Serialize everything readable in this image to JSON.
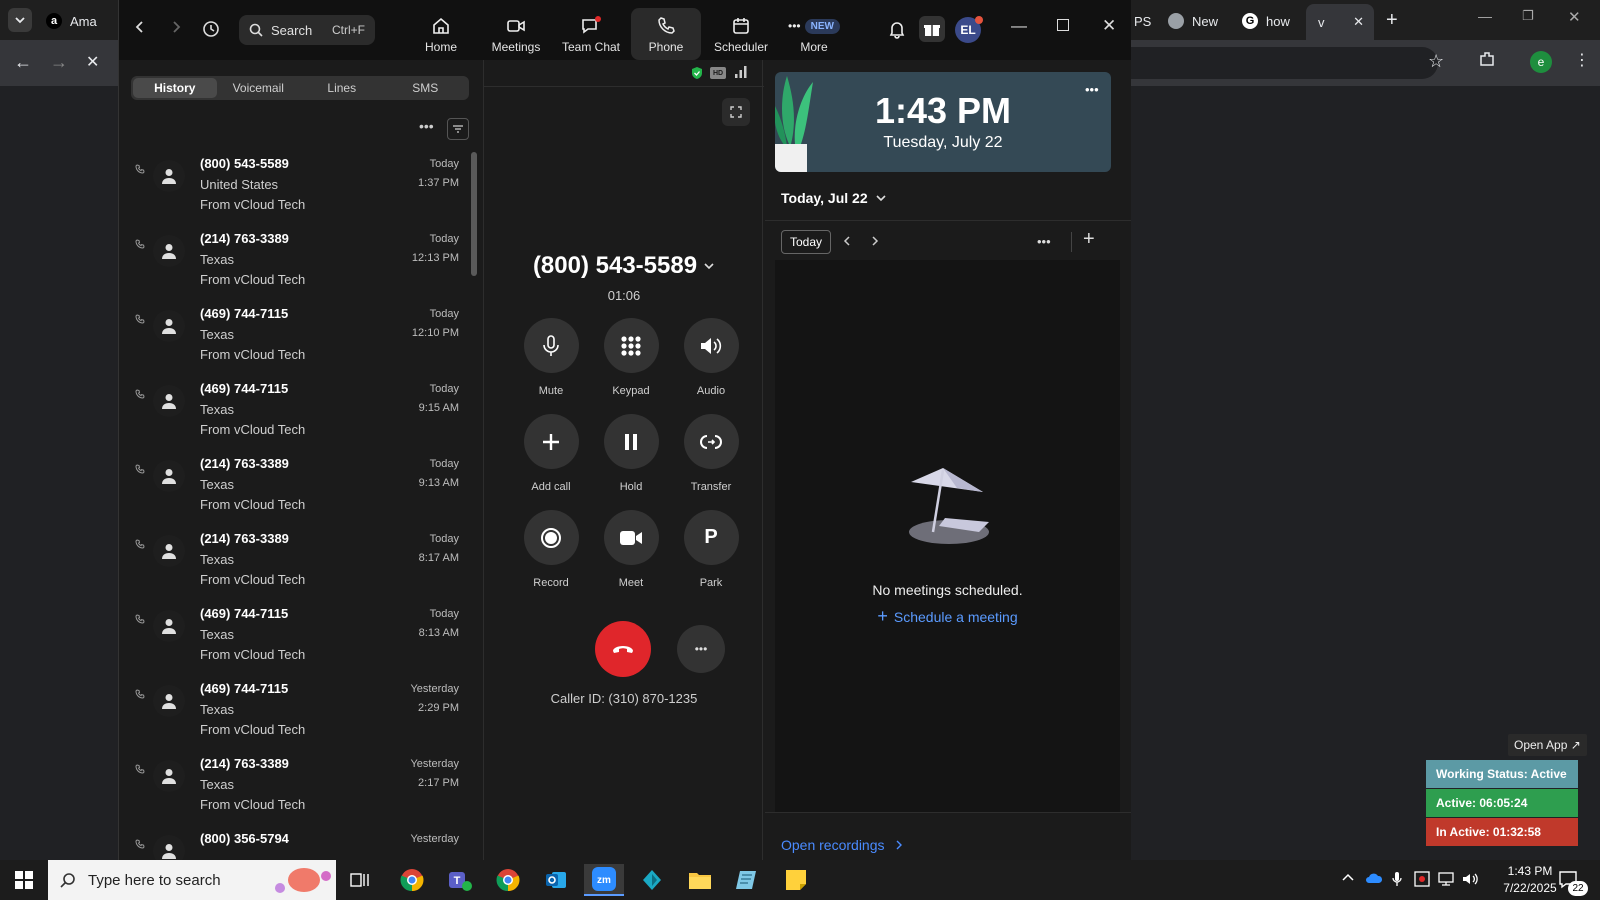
{
  "browser": {
    "tabs_left": [
      {
        "label": "Ama"
      }
    ],
    "tabs_right": [
      {
        "label": "PS"
      },
      {
        "label": "New"
      },
      {
        "label": "how"
      },
      {
        "label": "v"
      }
    ],
    "profile_initial": "e"
  },
  "zoom": {
    "search": {
      "label": "Search",
      "shortcut": "Ctrl+F"
    },
    "nav": [
      {
        "label": "Home",
        "icon": "home-icon"
      },
      {
        "label": "Meetings",
        "icon": "video-icon"
      },
      {
        "label": "Team Chat",
        "icon": "chat-icon"
      },
      {
        "label": "Phone",
        "icon": "phone-icon"
      },
      {
        "label": "Scheduler",
        "icon": "calendar-icon"
      },
      {
        "label": "More",
        "icon": "more-icon",
        "badge": "NEW"
      }
    ],
    "avatar_initials": "EL",
    "phone": {
      "subtabs": [
        "History",
        "Voicemail",
        "Lines",
        "SMS"
      ],
      "active_subtab": "History",
      "history": [
        {
          "number": "(800) 543-5589",
          "location": "United States",
          "source": "From vCloud Tech",
          "day": "Today",
          "time": "1:37 PM"
        },
        {
          "number": "(214) 763-3389",
          "location": "Texas",
          "source": "From vCloud Tech",
          "day": "Today",
          "time": "12:13 PM"
        },
        {
          "number": "(469) 744-7115",
          "location": "Texas",
          "source": "From vCloud Tech",
          "day": "Today",
          "time": "12:10 PM"
        },
        {
          "number": "(469) 744-7115",
          "location": "Texas",
          "source": "From vCloud Tech",
          "day": "Today",
          "time": "9:15 AM"
        },
        {
          "number": "(214) 763-3389",
          "location": "Texas",
          "source": "From vCloud Tech",
          "day": "Today",
          "time": "9:13 AM"
        },
        {
          "number": "(214) 763-3389",
          "location": "Texas",
          "source": "From vCloud Tech",
          "day": "Today",
          "time": "8:17 AM"
        },
        {
          "number": "(469) 744-7115",
          "location": "Texas",
          "source": "From vCloud Tech",
          "day": "Today",
          "time": "8:13 AM"
        },
        {
          "number": "(469) 744-7115",
          "location": "Texas",
          "source": "From vCloud Tech",
          "day": "Yesterday",
          "time": "2:29 PM"
        },
        {
          "number": "(214) 763-3389",
          "location": "Texas",
          "source": "From vCloud Tech",
          "day": "Yesterday",
          "time": "2:17 PM"
        },
        {
          "number": "(800) 356-5794",
          "location": "",
          "source": "",
          "day": "Yesterday",
          "time": ""
        }
      ]
    },
    "call": {
      "number": "(800) 543-5589",
      "duration": "01:06",
      "buttons": [
        {
          "label": "Mute",
          "icon": "microphone-icon"
        },
        {
          "label": "Keypad",
          "icon": "keypad-icon"
        },
        {
          "label": "Audio",
          "icon": "speaker-icon"
        },
        {
          "label": "Add call",
          "icon": "plus-icon"
        },
        {
          "label": "Hold",
          "icon": "pause-icon"
        },
        {
          "label": "Transfer",
          "icon": "transfer-icon"
        },
        {
          "label": "Record",
          "icon": "record-icon"
        },
        {
          "label": "Meet",
          "icon": "video-camera-icon"
        },
        {
          "label": "Park",
          "icon": "park-icon",
          "glyph": "P"
        }
      ],
      "caller_id": "Caller ID: (310) 870-1235"
    },
    "calendar": {
      "clock_time": "1:43 PM",
      "clock_date": "Tuesday, July 22",
      "date_selector": "Today, Jul 22",
      "today_button": "Today",
      "empty_text": "No meetings scheduled.",
      "schedule_link": "Schedule a meeting",
      "open_recordings": "Open recordings"
    }
  },
  "widget": {
    "open_app": "Open App ↗",
    "working_status": "Working Status: Active",
    "active": "Active: 06:05:24",
    "inactive": "In Active: 01:32:58",
    "colors": {
      "working": "#5c9aa5",
      "active": "#2e9e4f",
      "inactive": "#c0392b"
    }
  },
  "taskbar": {
    "search_placeholder": "Type here to search",
    "time": "1:43 PM",
    "date": "7/22/2025",
    "notification_count": "22"
  }
}
